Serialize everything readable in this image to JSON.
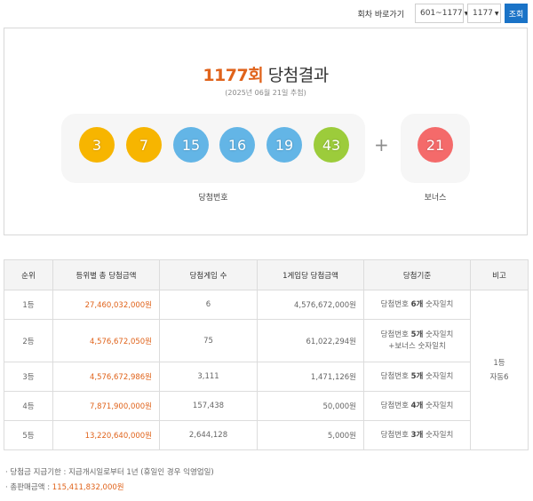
{
  "nav": {
    "label": "회차 바로가기",
    "range_value": "601~1177",
    "round_value": "1177",
    "go_label": "조회"
  },
  "result": {
    "round": "1177회",
    "title": "당첨결과",
    "draw_date": "(2025년 06월 21일 추첨)",
    "numbers": [
      {
        "value": "3",
        "color": "#f7b500"
      },
      {
        "value": "7",
        "color": "#f7b500"
      },
      {
        "value": "15",
        "color": "#63b5e6"
      },
      {
        "value": "16",
        "color": "#63b5e6"
      },
      {
        "value": "19",
        "color": "#63b5e6"
      },
      {
        "value": "43",
        "color": "#9ccc3b"
      }
    ],
    "plus": "+",
    "bonus": {
      "value": "21",
      "color": "#f46a6a"
    },
    "winning_caption": "당첨번호",
    "bonus_caption": "보너스"
  },
  "table": {
    "headers": [
      "순위",
      "등위별 총 당첨금액",
      "당첨게임 수",
      "1게임당 당첨금액",
      "당첨기준",
      "비고"
    ],
    "rows": [
      {
        "rank": "1등",
        "total": "27,460,032,000원",
        "games": "6",
        "per_game": "4,576,672,000원",
        "crit_pre": "당첨번호 ",
        "crit_bold": "6개",
        "crit_post": " 숫자일치",
        "crit_line2": ""
      },
      {
        "rank": "2등",
        "total": "4,576,672,050원",
        "games": "75",
        "per_game": "61,022,294원",
        "crit_pre": "당첨번호 ",
        "crit_bold": "5개",
        "crit_post": " 숫자일치",
        "crit_line2": "+보너스 숫자일치"
      },
      {
        "rank": "3등",
        "total": "4,576,672,986원",
        "games": "3,111",
        "per_game": "1,471,126원",
        "crit_pre": "당첨번호 ",
        "crit_bold": "5개",
        "crit_post": " 숫자일치",
        "crit_line2": ""
      },
      {
        "rank": "4등",
        "total": "7,871,900,000원",
        "games": "157,438",
        "per_game": "50,000원",
        "crit_pre": "당첨번호 ",
        "crit_bold": "4개",
        "crit_post": " 숫자일치",
        "crit_line2": ""
      },
      {
        "rank": "5등",
        "total": "13,220,640,000원",
        "games": "2,644,128",
        "per_game": "5,000원",
        "crit_pre": "당첨번호 ",
        "crit_bold": "3개",
        "crit_post": " 숫자일치",
        "crit_line2": ""
      }
    ],
    "note_line1": "1등",
    "note_line2": "자동6"
  },
  "footer": {
    "period": "· 당첨금 지급기한 : 지급개시일로부터 1년 (휴일인 경우 익영업일)",
    "sales_label": "· 총판매금액 : ",
    "sales_value": "115,411,832,000원"
  }
}
